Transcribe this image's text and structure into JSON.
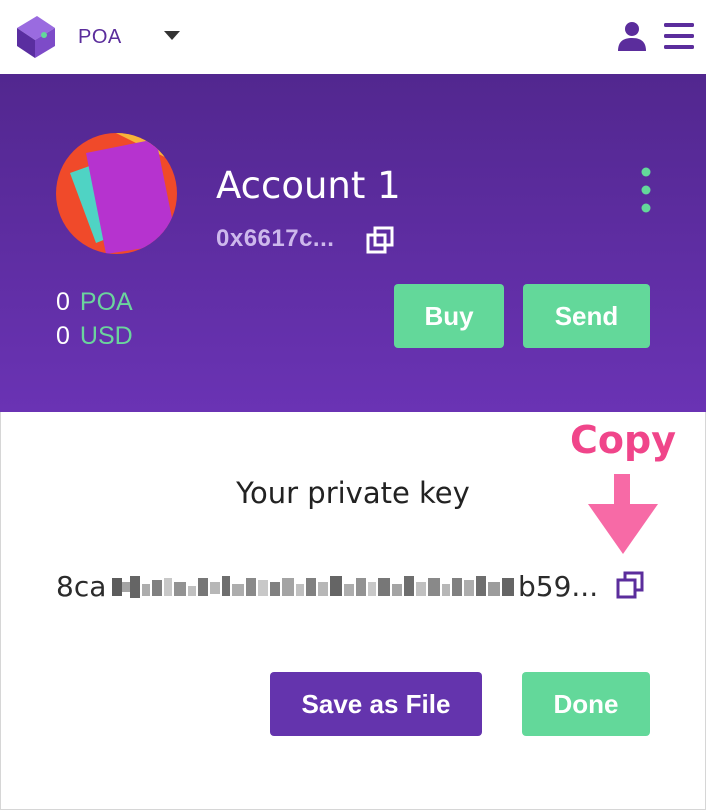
{
  "header": {
    "network_label": "POA",
    "logo_icon": "wallet-logo-icon",
    "caret_icon": "caret-down-icon",
    "account_icon": "user-icon",
    "menu_icon": "hamburger-menu-icon"
  },
  "account": {
    "name": "Account 1",
    "address_short": "0x6617c...",
    "address_copy_icon": "copy-icon",
    "options_icon": "kebab-menu-icon",
    "balances": [
      {
        "amount": "0",
        "unit": "POA"
      },
      {
        "amount": "0",
        "unit": "USD"
      }
    ],
    "buy_label": "Buy",
    "send_label": "Send"
  },
  "annotation": {
    "copy_label": "Copy",
    "arrow_icon": "arrow-down-icon"
  },
  "private_key": {
    "title": "Your private key",
    "visible_start": "8ca",
    "visible_end": "b59...",
    "copy_icon": "copy-icon"
  },
  "actions": {
    "save_label": "Save as File",
    "done_label": "Done"
  },
  "colors": {
    "brand_purple": "#5b2d9c",
    "panel_top": "#52278f",
    "panel_bottom": "#6a33b4",
    "accent_green": "#63d89a",
    "annotation_pink": "#f0458a"
  }
}
